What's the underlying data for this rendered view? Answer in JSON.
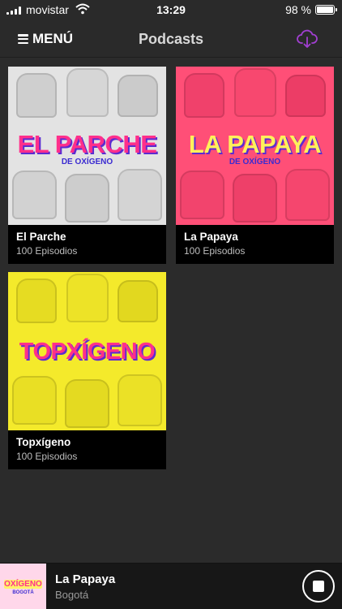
{
  "status_bar": {
    "carrier": "movistar",
    "time": "13:29",
    "battery": "98 %",
    "battery_level": 0.98
  },
  "nav": {
    "menu_label": "MENÚ",
    "title": "Podcasts",
    "download_icon": "cloud-download-icon",
    "accent": "#a13fd1"
  },
  "podcasts": [
    {
      "name": "El Parche",
      "episodes": "100 Episodios",
      "logo": "EL PARCHE",
      "logo_sub": "DE OXÍGENO",
      "bg": "#e3e3e3",
      "logo_color": "#ff2f8b"
    },
    {
      "name": "La Papaya",
      "episodes": "100 Episodios",
      "logo": "LA PAPAYA",
      "logo_sub": "DE OXÍGENO",
      "bg": "#ff4f77",
      "logo_color": "#fff15a"
    },
    {
      "name": "Topxígeno",
      "episodes": "100 Episodios",
      "logo": "TOPXÍGENO",
      "logo_sub": "",
      "bg": "#f4ea2b",
      "logo_color": "#ff2f8b"
    }
  ],
  "player": {
    "title": "La Papaya",
    "subtitle": "Bogotá",
    "thumb_logo": "OXÍGENO",
    "thumb_sub": "BOGOTÁ",
    "stop_icon": "stop-icon"
  }
}
